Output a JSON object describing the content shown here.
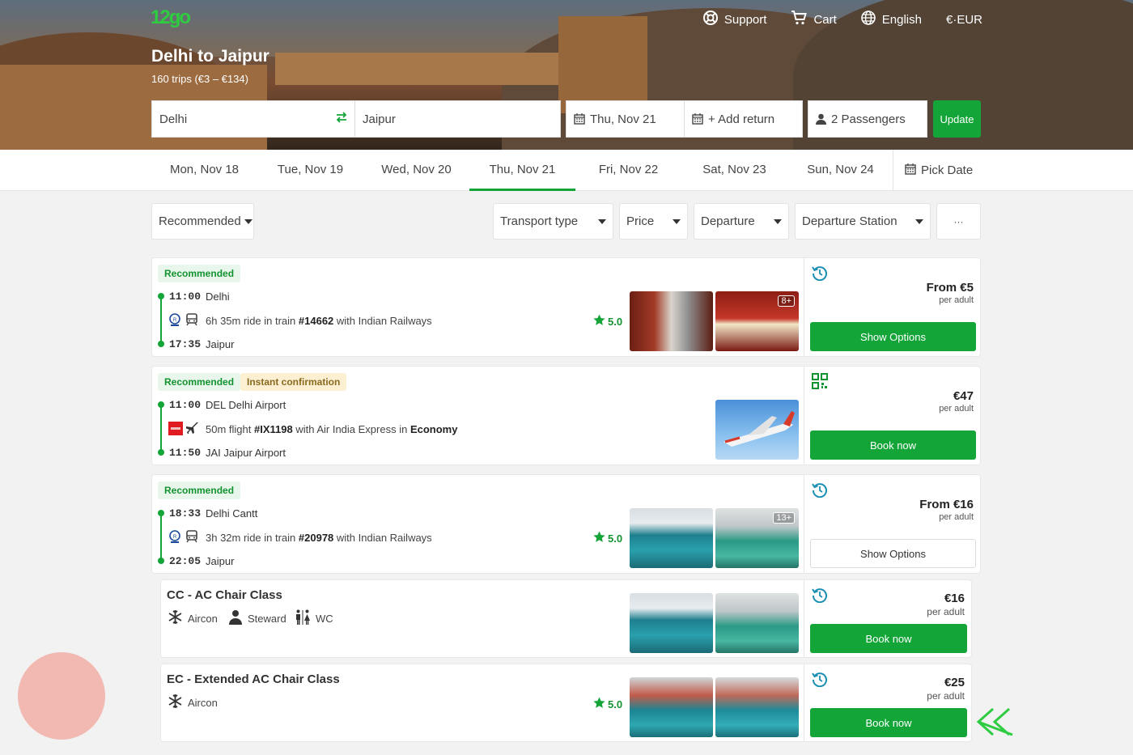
{
  "header": {
    "logo_text": "12go",
    "nav": [
      {
        "icon": "lifebuoy-icon",
        "label": "Support"
      },
      {
        "icon": "cart-icon",
        "label": "Cart"
      },
      {
        "icon": "globe-icon",
        "label": "English"
      },
      {
        "icon": "",
        "label": "€·EUR"
      }
    ],
    "title": "Delhi to Jaipur",
    "subtitle": "160 trips (€3 – €134)"
  },
  "search": {
    "from": "Delhi",
    "to": "Jaipur",
    "date": "Thu, Nov 21",
    "return": "+ Add return",
    "passengers": "2 Passengers",
    "update_label": "Update"
  },
  "dates": {
    "tabs": [
      "Mon, Nov 18",
      "Tue, Nov 19",
      "Wed, Nov 20",
      "Thu, Nov 21",
      "Fri, Nov 22",
      "Sat, Nov 23",
      "Sun, Nov 24"
    ],
    "active_index": 3,
    "pick_label": "Pick Date"
  },
  "filters": {
    "sort": "Recommended",
    "transport": "Transport type",
    "price": "Price",
    "departure": "Departure",
    "station": "Departure Station",
    "more": "···"
  },
  "results": [
    {
      "badges": [
        "Recommended"
      ],
      "dep_time": "11:00",
      "dep_place": "Delhi",
      "ride_pre": "6h 35m ride in train ",
      "ride_num": "#14662",
      "ride_post": " with Indian Railways",
      "arr_time": "17:35",
      "arr_place": "Jaipur",
      "rating": "5.0",
      "photo_count": "8+",
      "price": "From €5",
      "per": "per adult",
      "button": "Show Options"
    },
    {
      "badges": [
        "Recommended",
        "Instant confirmation"
      ],
      "dep_time": "11:00",
      "dep_place": "DEL Delhi Airport",
      "ride_pre": "50m flight ",
      "ride_num": "#IX1198",
      "ride_post": " with Air India Express in ",
      "ride_class": "Economy",
      "arr_time": "11:50",
      "arr_place": "JAI Jaipur Airport",
      "price": "€47",
      "per": "per adult",
      "button": "Book now"
    },
    {
      "badges": [
        "Recommended"
      ],
      "dep_time": "18:33",
      "dep_place": "Delhi Cantt",
      "ride_pre": "3h 32m ride in train ",
      "ride_num": "#20978",
      "ride_post": " with Indian Railways",
      "arr_time": "22:05",
      "arr_place": "Jaipur",
      "rating": "5.0",
      "photo_count": "13+",
      "price": "From €16",
      "per": "per adult",
      "button": "Show Options"
    }
  ],
  "classes": [
    {
      "title": "CC - AC Chair Class",
      "amenities": [
        "Aircon",
        "Steward",
        "WC"
      ],
      "price": "€16",
      "per": "per adult",
      "button": "Book now"
    },
    {
      "title": "EC - Extended AC Chair Class",
      "amenities": [
        "Aircon"
      ],
      "rating": "5.0",
      "price": "€25",
      "per": "per adult",
      "button": "Book now"
    }
  ],
  "colors": {
    "brand_green": "#13a538",
    "accent_blue": "#1b8fb3"
  }
}
